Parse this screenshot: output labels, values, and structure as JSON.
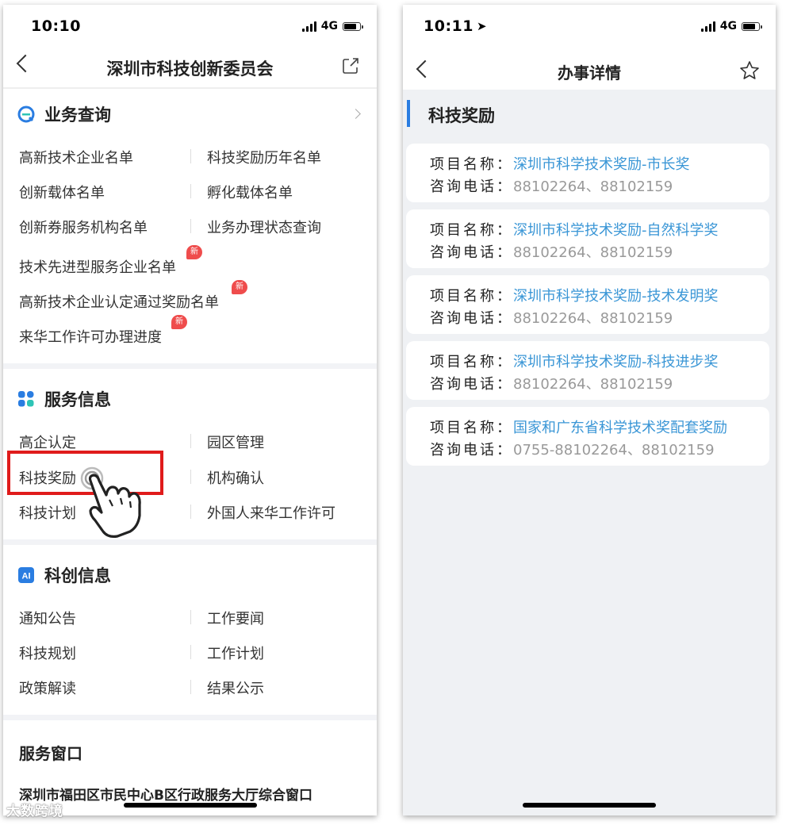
{
  "left": {
    "status": {
      "time": "10:10",
      "network": "4G"
    },
    "nav": {
      "title": "深圳市科技创新委员会"
    },
    "business_query": {
      "title": "业务查询",
      "items": [
        "高新技术企业名单",
        "科技奖励历年名单",
        "创新载体名单",
        "孵化载体名单",
        "创新券服务机构名单",
        "业务办理状态查询"
      ],
      "new_items": [
        "技术先进型服务企业名单",
        "高新技术企业认定通过奖励名单",
        "来华工作许可办理进度"
      ],
      "new_badge": "新"
    },
    "service_info": {
      "title": "服务信息",
      "items": [
        "高企认定",
        "园区管理",
        "科技奖励",
        "机构确认",
        "科技计划",
        "外国人来华工作许可"
      ]
    },
    "tech_info": {
      "title": "科创信息",
      "icon_text": "AI",
      "items": [
        "通知公告",
        "工作要闻",
        "科技规划",
        "工作计划",
        "政策解读",
        "结果公示"
      ]
    },
    "service_window": {
      "title": "服务窗口",
      "address": "深圳市福田区市民中心B区行政服务大厅综合窗口"
    },
    "watermark": "大数跨境"
  },
  "right": {
    "status": {
      "time": "10:11",
      "network": "4G"
    },
    "nav": {
      "title": "办事详情"
    },
    "section_title": "科技奖励",
    "project_label": "项目名称：",
    "phone_label": "咨询电话：",
    "cards": [
      {
        "project": "深圳市科学技术奖励-市长奖",
        "phone": "88102264、88102159"
      },
      {
        "project": "深圳市科学技术奖励-自然科学奖",
        "phone": "88102264、88102159"
      },
      {
        "project": "深圳市科学技术奖励-技术发明奖",
        "phone": "88102264、88102159"
      },
      {
        "project": "深圳市科学技术奖励-科技进步奖",
        "phone": "88102264、88102159"
      },
      {
        "project": "国家和广东省科学技术奖配套奖励",
        "phone": "0755-88102264、88102159"
      }
    ]
  },
  "colors": {
    "accent_blue": "#2a7de1",
    "link_blue": "#3a96d6",
    "highlight_red": "#e01b1b",
    "badge_red": "#ef4c4c"
  }
}
